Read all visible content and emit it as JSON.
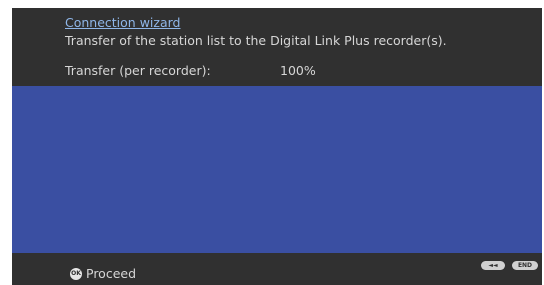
{
  "header": {
    "title": "Connection wizard",
    "description": "Transfer of the station list to the Digital Link Plus recorder(s).",
    "transfer_label": "Transfer (per recorder):",
    "transfer_value": "100%"
  },
  "footer": {
    "ok_icon_label": "OK",
    "proceed_label": "Proceed",
    "rewind_icon": "rewind-icon",
    "rewind_label": "◄◄",
    "end_label": "END"
  },
  "colors": {
    "header_bg": "#303030",
    "main_bg": "#3a4fa2",
    "link": "#8fb6e8",
    "text": "#d6d6d6"
  }
}
